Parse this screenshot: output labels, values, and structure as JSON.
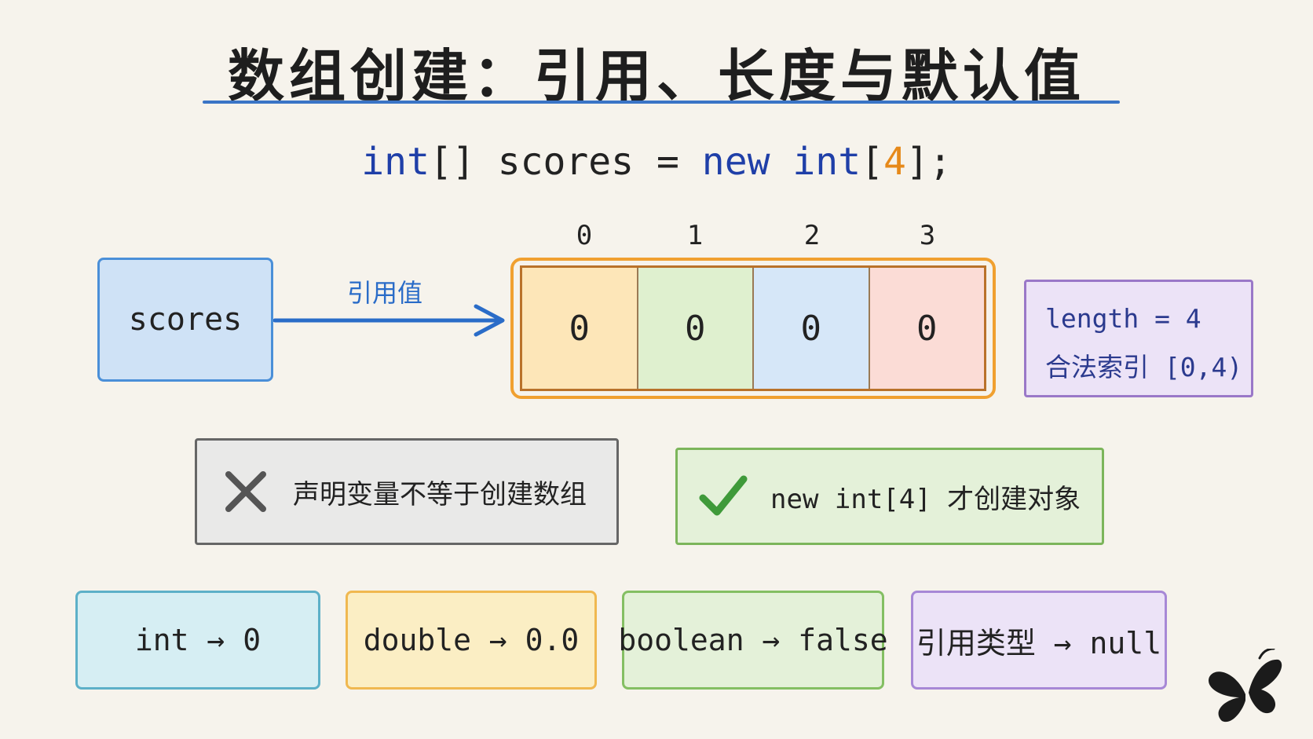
{
  "title": "数组创建：引用、长度与默认值",
  "code": {
    "type_kw": "int",
    "brackets": "[]",
    "var_name": "scores",
    "equals": "=",
    "new_kw": "new",
    "type_kw2": "int",
    "open_bracket": "[",
    "size": "4",
    "close": "];"
  },
  "reference": {
    "variable": "scores",
    "arrow_label": "引用值"
  },
  "array": {
    "indices": [
      "0",
      "1",
      "2",
      "3"
    ],
    "values": [
      "0",
      "0",
      "0",
      "0"
    ],
    "cell_colors": [
      "#fde6b8",
      "#dff0cf",
      "#d6e7f8",
      "#fbdcd6"
    ]
  },
  "length_note": {
    "line1": "length = 4",
    "line2": "合法索引 [0,4)"
  },
  "wrong_note": {
    "icon": "x-mark-icon",
    "text": "声明变量不等于创建数组"
  },
  "right_note": {
    "icon": "check-mark-icon",
    "text": "new int[4] 才创建对象"
  },
  "defaults": {
    "int": "int → 0",
    "double": "double → 0.0",
    "boolean": "boolean → false",
    "ref": "引用类型 → null"
  },
  "colors": {
    "accent_blue": "#2a6cc8",
    "array_border": "#f0a030",
    "size_orange": "#e6891a"
  }
}
